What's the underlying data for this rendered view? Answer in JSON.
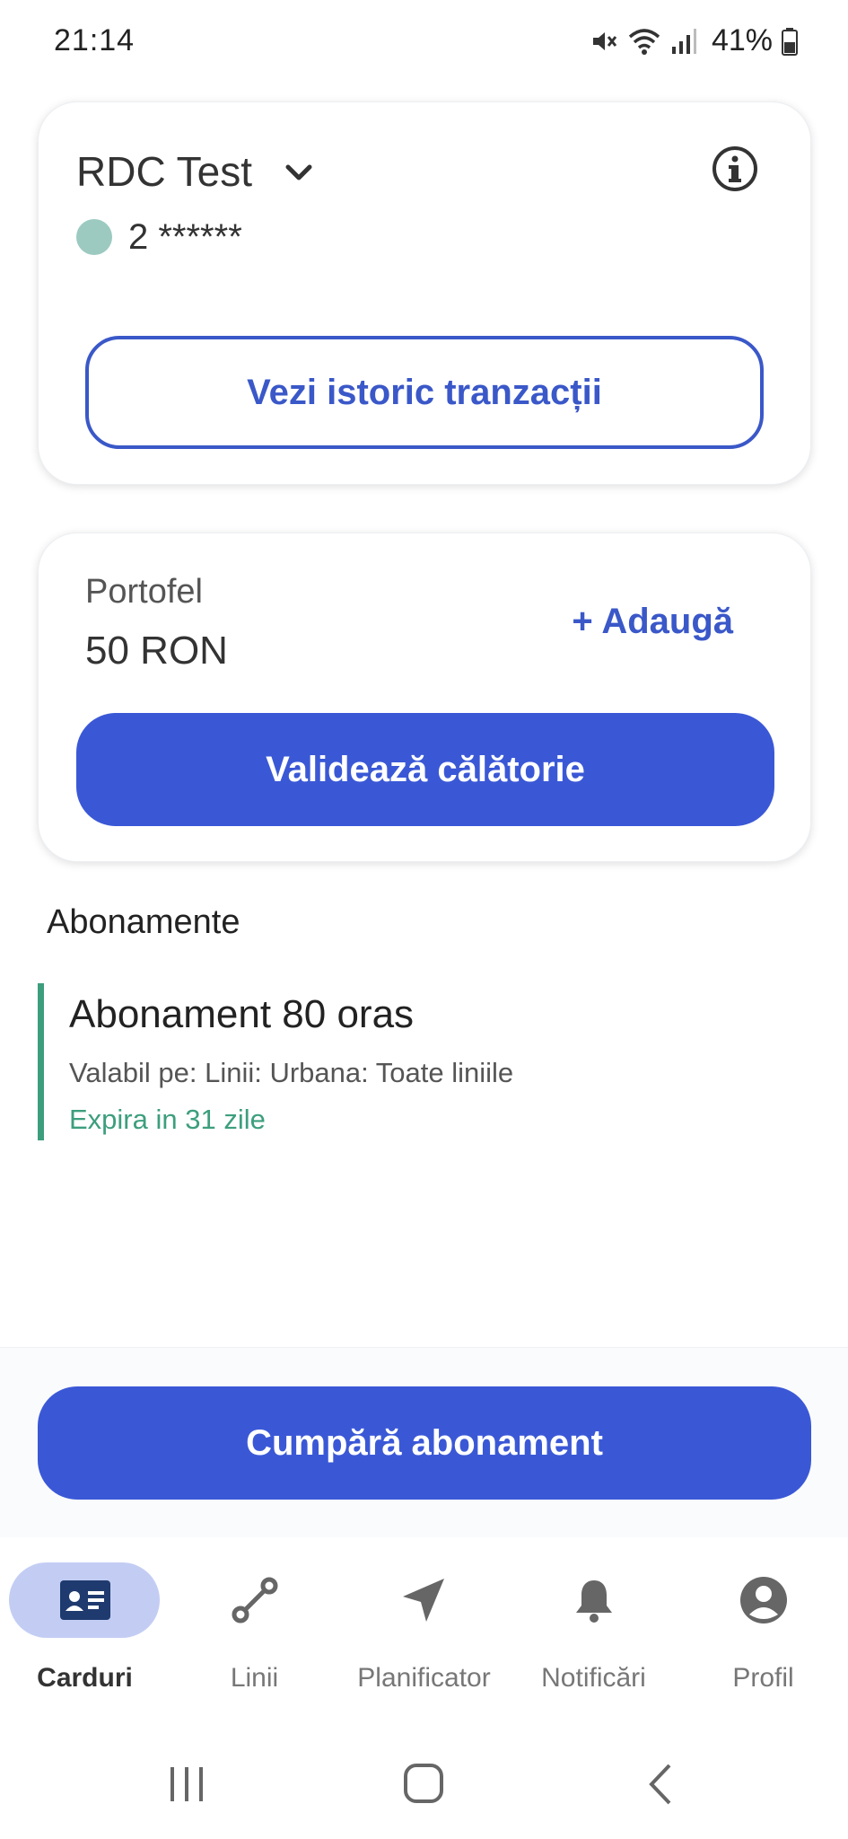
{
  "status_bar": {
    "time": "21:14",
    "battery": "41%"
  },
  "account_card": {
    "name": "RDC Test",
    "number": "2 ******",
    "history_button": "Vezi istoric tranzacții"
  },
  "wallet_card": {
    "label": "Portofel",
    "amount": "50 RON",
    "add_link": "+ Adaugă",
    "validate_button": "Validează călătorie"
  },
  "subscriptions": {
    "title": "Abonamente",
    "items": [
      {
        "name": "Abonament 80 oras",
        "validity": "Valabil pe: Linii: Urbana: Toate liniile",
        "expiry": "Expira in 31 zile"
      }
    ]
  },
  "buy_button": "Cumpără abonament",
  "bottom_nav": {
    "items": [
      {
        "label": "Carduri",
        "icon": "card-icon",
        "active": true
      },
      {
        "label": "Linii",
        "icon": "route-icon",
        "active": false
      },
      {
        "label": "Planificator",
        "icon": "navigation-arrow-icon",
        "active": false
      },
      {
        "label": "Notificări",
        "icon": "bell-icon",
        "active": false
      },
      {
        "label": "Profil",
        "icon": "profile-icon",
        "active": false
      }
    ]
  },
  "colors": {
    "primary": "#3a58d6",
    "accent_green": "#3d9e7e",
    "active_pill": "#c3cdf4",
    "status_dot": "#9ccac0"
  }
}
